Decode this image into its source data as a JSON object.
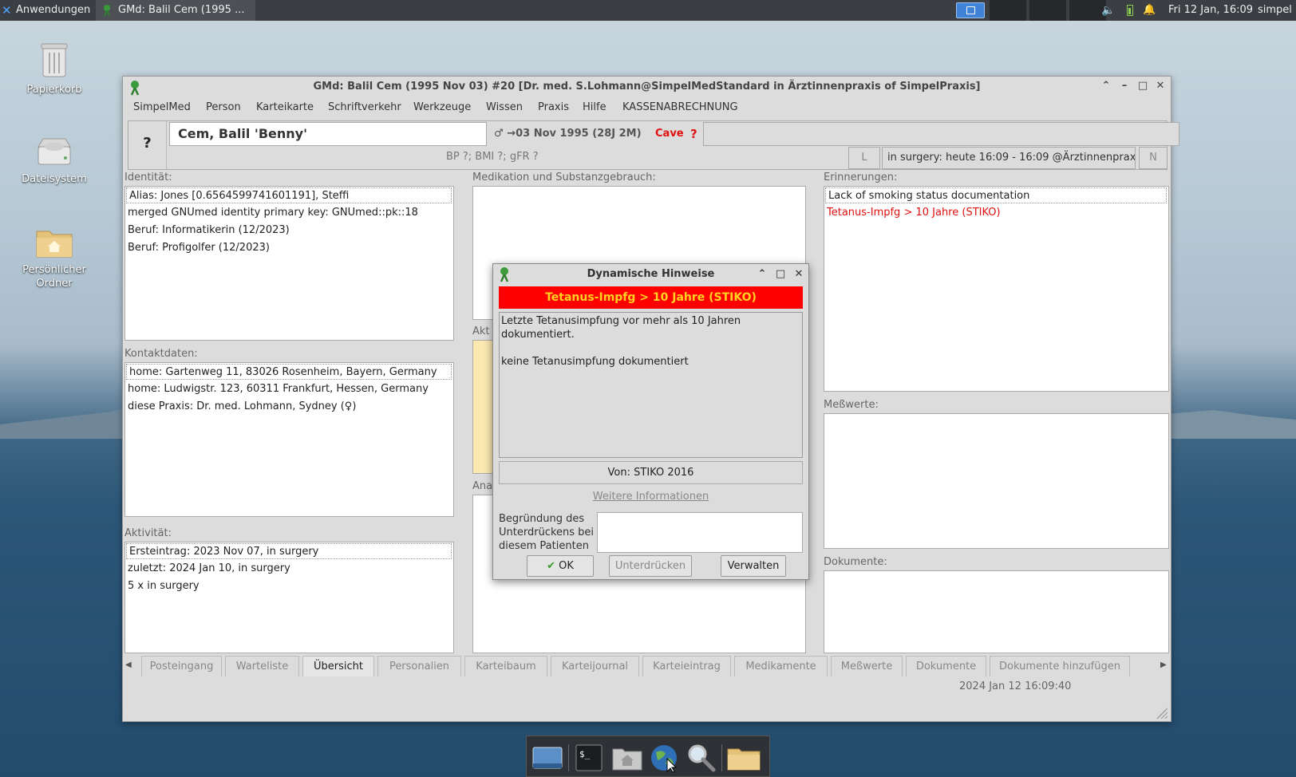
{
  "topbar": {
    "apps_label": "Anwendungen",
    "task_label": "GMd:  Balil Cem (1995 ...",
    "clock": "Fri 12 Jan, 16:09",
    "user": "simpel"
  },
  "desktop": {
    "icons": [
      {
        "label": "Papierkorb"
      },
      {
        "label": "Dateisystem"
      },
      {
        "label": "Persönlicher Ordner"
      }
    ]
  },
  "window": {
    "title": "GMd:  Balil Cem (1995 Nov 03) #20 [Dr. med. S.Lohmann@SimpelMedStandard in Ärztinnenpraxis of SimpelPraxis]",
    "menu": [
      "SimpelMed",
      "Person",
      "Karteikarte",
      "Schriftverkehr",
      "Werkzeuge",
      "Wissen",
      "Praxis",
      "Hilfe",
      "KASSENABRECHNUNG"
    ]
  },
  "patient": {
    "help_label": "?",
    "name": "Cem, Balil 'Benny'",
    "gender_symbol": "♂",
    "dob": "→03 Nov 1995 (28J 2M)",
    "cave_label": "Cave",
    "cave_marker": "?",
    "vitals": "BP ?; BMI ?; gFR ?",
    "prev_label": "L",
    "surgery": "in surgery: heute 16:09 - 16:09 @Ärztinnenpraxis",
    "next_label": "N"
  },
  "sections": {
    "identity": {
      "label": "Identität:",
      "lines": [
        "Alias: Jones [0.6564599741601191], Steffi",
        "merged GNUmed identity primary key: GNUmed::pk::18",
        "Beruf: Informatikerin (12/2023)",
        "Beruf: Profigolfer (12/2023)"
      ]
    },
    "contact": {
      "label": "Kontaktdaten:",
      "lines": [
        "home: Gartenweg 11, 83026 Rosenheim, Bayern, Germany",
        "home: Ludwigstr. 123, 60311 Frankfurt, Hessen, Germany",
        "diese Praxis:  Dr. med. Lohmann, Sydney (♀)"
      ]
    },
    "activity": {
      "label": "Aktivität:",
      "lines": [
        "Ersteintrag: 2023 Nov 07, in surgery",
        "zuletzt: 2024 Jan 10, in surgery",
        " 5 x in surgery"
      ]
    },
    "medication": {
      "label": "Medikation und Substanzgebrauch:"
    },
    "active_partial": {
      "label": "Akt"
    },
    "anamnesis_partial": {
      "label": "Ana"
    },
    "reminders": {
      "label": "Erinnerungen:",
      "lines": [
        "Lack of smoking status documentation",
        "Tetanus-Impfg > 10 Jahre (STIKO)"
      ]
    },
    "measurements": {
      "label": "Meßwerte:"
    },
    "documents": {
      "label": "Dokumente:"
    }
  },
  "tabs": [
    {
      "label": "Posteingang"
    },
    {
      "label": "Warteliste"
    },
    {
      "label": "Übersicht"
    },
    {
      "label": "Personalien"
    },
    {
      "label": "Karteibaum"
    },
    {
      "label": "Karteijournal"
    },
    {
      "label": "Karteieintrag"
    },
    {
      "label": "Medikamente"
    },
    {
      "label": "Meßwerte"
    },
    {
      "label": "Dokumente"
    },
    {
      "label": "Dokumente hinzufügen"
    }
  ],
  "statusbar": {
    "datetime": "2024 Jan 12  16:09:40"
  },
  "dialog": {
    "title": "Dynamische Hinweise",
    "banner": "Tetanus-Impfg > 10 Jahre (STIKO)",
    "text": "Letzte Tetanusimpfung vor mehr als 10 Jahren\ndokumentiert.\n\nkeine Tetanusimpfung dokumentiert",
    "source": "Von: STIKO 2016",
    "more_info": "Weitere Informationen",
    "reason_label": "Begründung des Unterdrückens bei diesem Patienten",
    "reason_value": "",
    "ok_label": "OK",
    "suppress_label": "Unterdrücken",
    "manage_label": "Verwalten"
  },
  "colors": {
    "alert_red": "#ff0000",
    "alert_text_yellow": "#ffd21f",
    "cave_red": "#e01010"
  }
}
